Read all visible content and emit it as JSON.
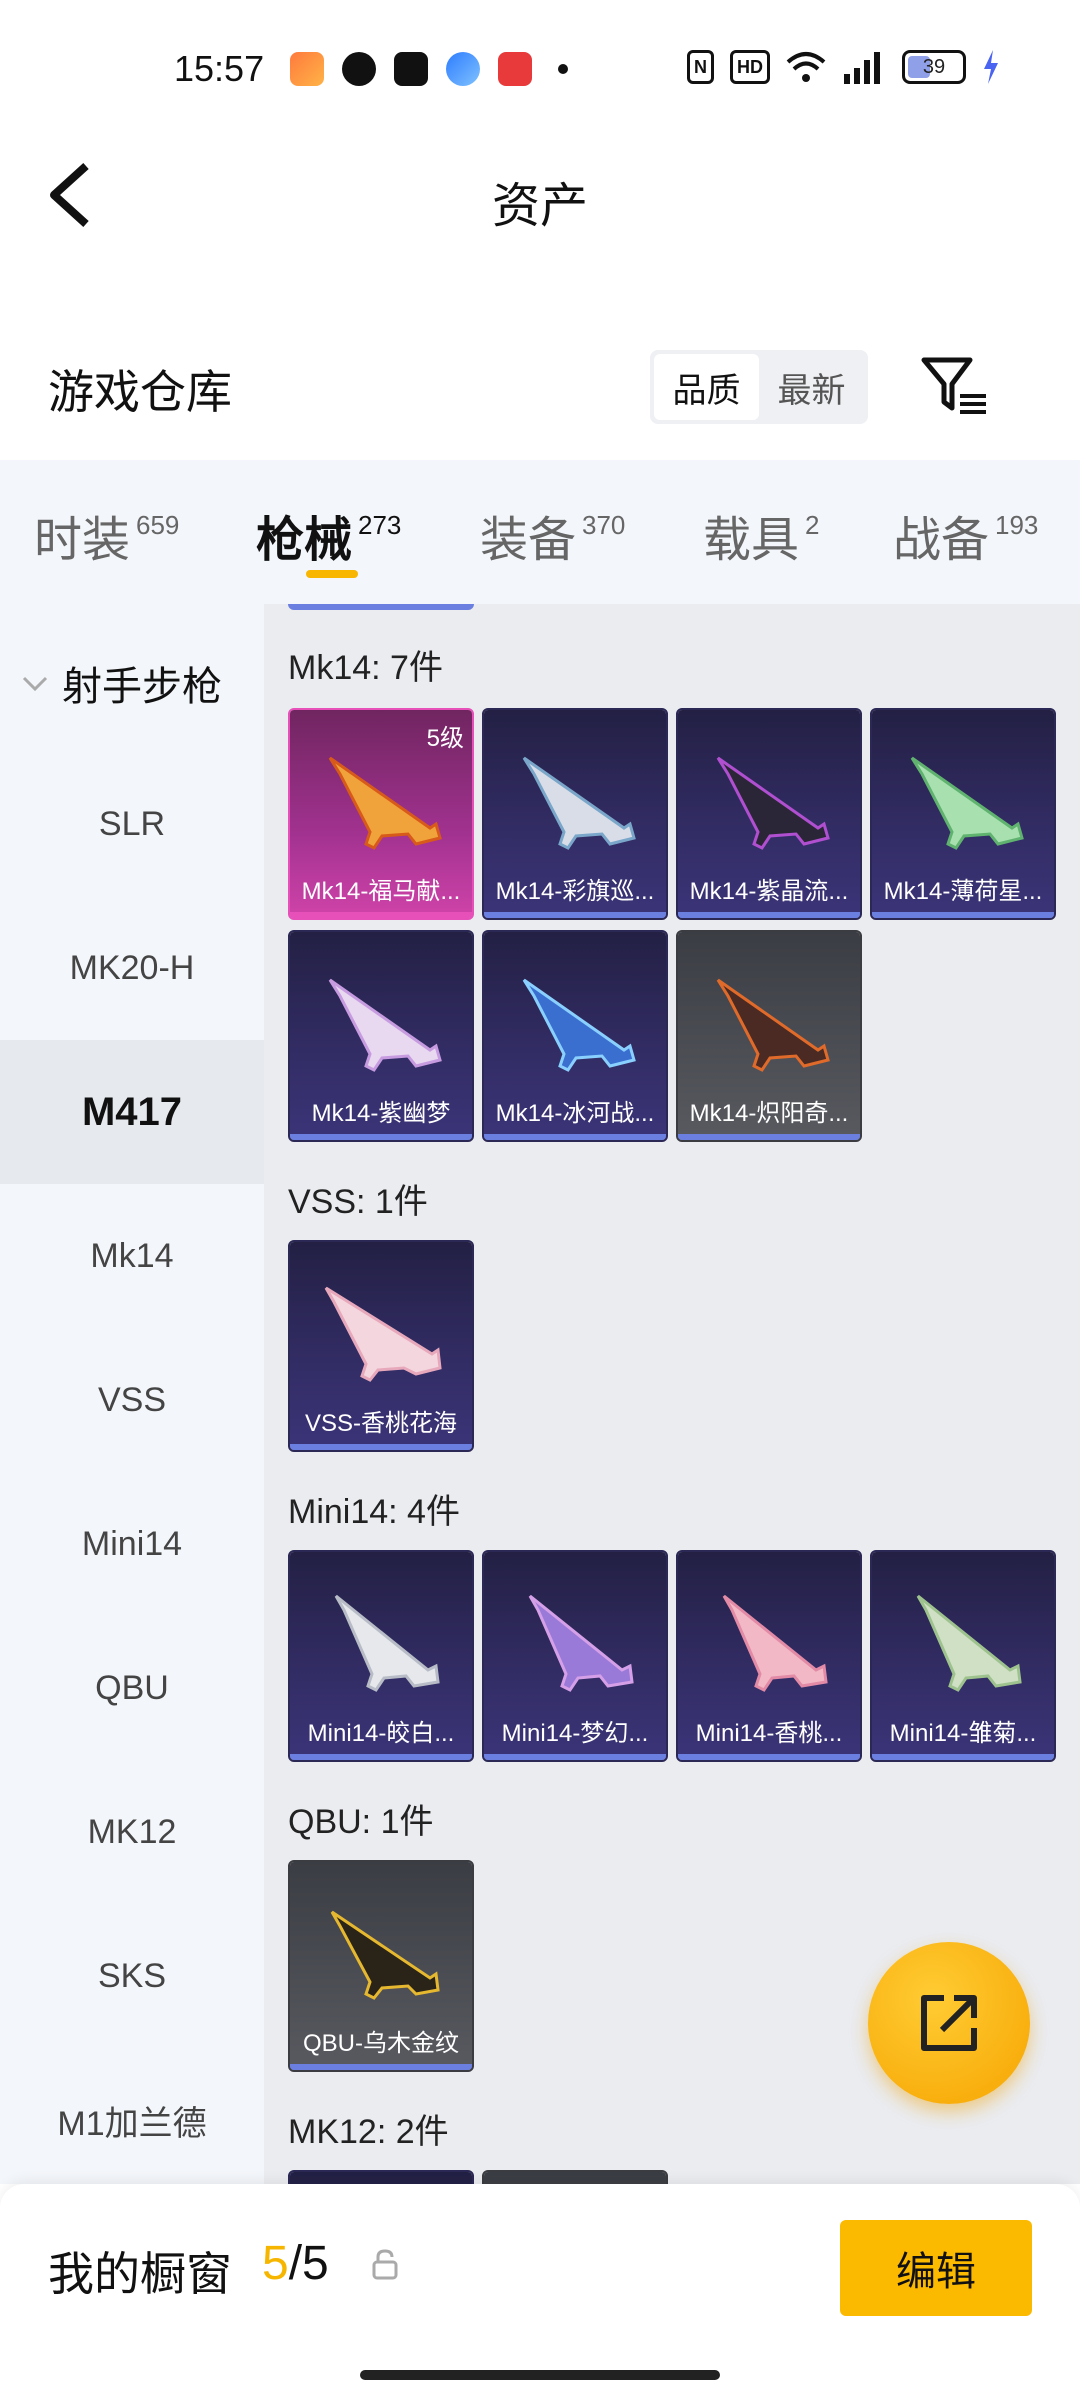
{
  "status_bar": {
    "time": "15:57",
    "battery": "39",
    "hd": "HD",
    "nfc": "N"
  },
  "header": {
    "title": "资产"
  },
  "warehouse": {
    "title": "游戏仓库",
    "sort_options": [
      "品质",
      "最新"
    ]
  },
  "tabs": [
    {
      "label": "时装",
      "count": "659"
    },
    {
      "label": "枪械",
      "count": "273"
    },
    {
      "label": "装备",
      "count": "370"
    },
    {
      "label": "载具",
      "count": "2"
    },
    {
      "label": "战备",
      "count": "193"
    }
  ],
  "sidebar": {
    "category": "射手步枪",
    "items": [
      "SLR",
      "MK20-H",
      "M417",
      "Mk14",
      "VSS",
      "Mini14",
      "QBU",
      "MK12",
      "SKS",
      "M1加兰德"
    ],
    "active": "M417"
  },
  "groups": [
    {
      "title": "Mk14: 7件",
      "items": [
        {
          "name": "Mk14-福马献...",
          "level": "5级",
          "rarity": "pink"
        },
        {
          "name": "Mk14-彩旗巡...",
          "rarity": "purple"
        },
        {
          "name": "Mk14-紫晶流...",
          "rarity": "purple"
        },
        {
          "name": "Mk14-薄荷星...",
          "rarity": "purple"
        },
        {
          "name": "Mk14-紫幽梦",
          "rarity": "purple"
        },
        {
          "name": "Mk14-冰河战...",
          "rarity": "purple"
        },
        {
          "name": "Mk14-炽阳奇...",
          "rarity": "gray"
        }
      ]
    },
    {
      "title": "VSS: 1件",
      "items": [
        {
          "name": "VSS-香桃花海",
          "rarity": "purple"
        }
      ]
    },
    {
      "title": "Mini14: 4件",
      "items": [
        {
          "name": "Mini14-皎白...",
          "rarity": "purple"
        },
        {
          "name": "Mini14-梦幻...",
          "rarity": "purple"
        },
        {
          "name": "Mini14-香桃...",
          "rarity": "purple"
        },
        {
          "name": "Mini14-雏菊...",
          "rarity": "purple"
        }
      ]
    },
    {
      "title": "QBU: 1件",
      "items": [
        {
          "name": "QBU-乌木金纹",
          "rarity": "gray"
        }
      ]
    },
    {
      "title": "MK12: 2件",
      "items": []
    }
  ],
  "bottom_bar": {
    "title": "我的橱窗",
    "current": "5",
    "total": "5",
    "edit_label": "编辑"
  },
  "colors": {
    "accent": "#fbb900",
    "rarity_purple": "#332d66",
    "rarity_pink": "#d043a9",
    "rarity_gray": "#585a60",
    "strip": "#6b7fe0"
  }
}
